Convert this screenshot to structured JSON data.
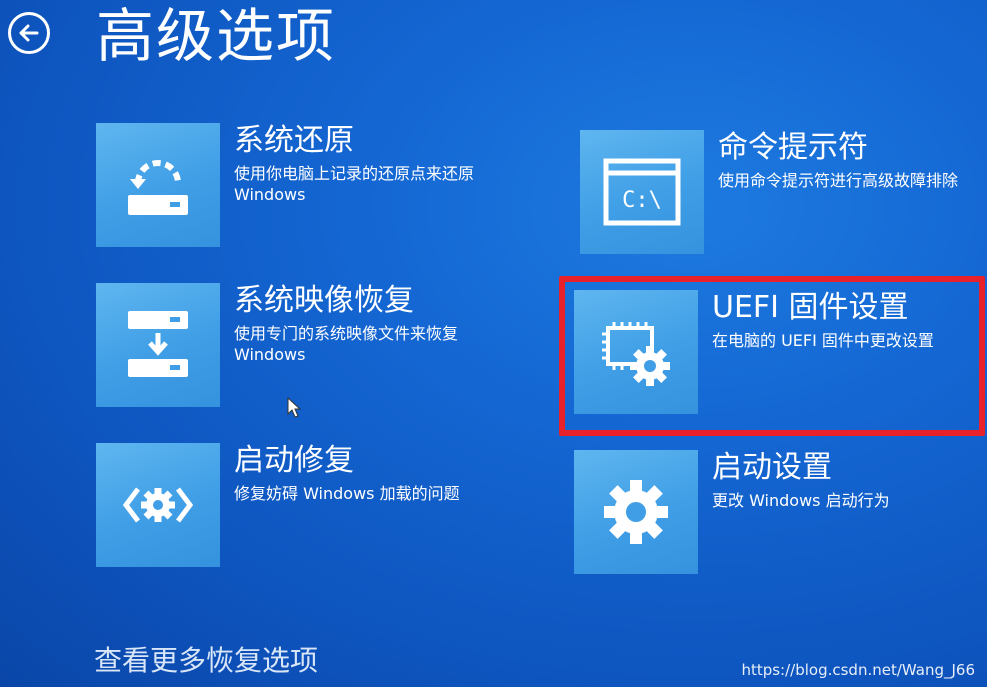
{
  "header": {
    "title": "高级选项",
    "back_icon": "back-arrow-icon"
  },
  "options": [
    {
      "id": "system-restore",
      "icon": "restore-icon",
      "label": "系统还原",
      "description": "使用你电脑上记录的还原点来还原 Windows"
    },
    {
      "id": "command-prompt",
      "icon": "command-prompt-icon",
      "label": "命令提示符",
      "description": "使用命令提示符进行高级故障排除"
    },
    {
      "id": "system-image-recovery",
      "icon": "image-recovery-icon",
      "label": "系统映像恢复",
      "description": "使用专门的系统映像文件来恢复 Windows"
    },
    {
      "id": "uefi-firmware-settings",
      "icon": "uefi-chip-gear-icon",
      "label": "UEFI 固件设置",
      "description": "在电脑的 UEFI 固件中更改设置"
    },
    {
      "id": "startup-repair",
      "icon": "startup-repair-icon",
      "label": "启动修复",
      "description": "修复妨碍 Windows 加载的问题"
    },
    {
      "id": "startup-settings",
      "icon": "gear-icon",
      "label": "启动设置",
      "description": "更改 Windows 启动行为"
    }
  ],
  "footer": {
    "more_options": "查看更多恢复选项",
    "watermark": "https://blog.csdn.net/Wang_J66"
  },
  "colors": {
    "background": "#1466d2",
    "tile": "#3f9ee6",
    "highlight": "#e8212b"
  }
}
